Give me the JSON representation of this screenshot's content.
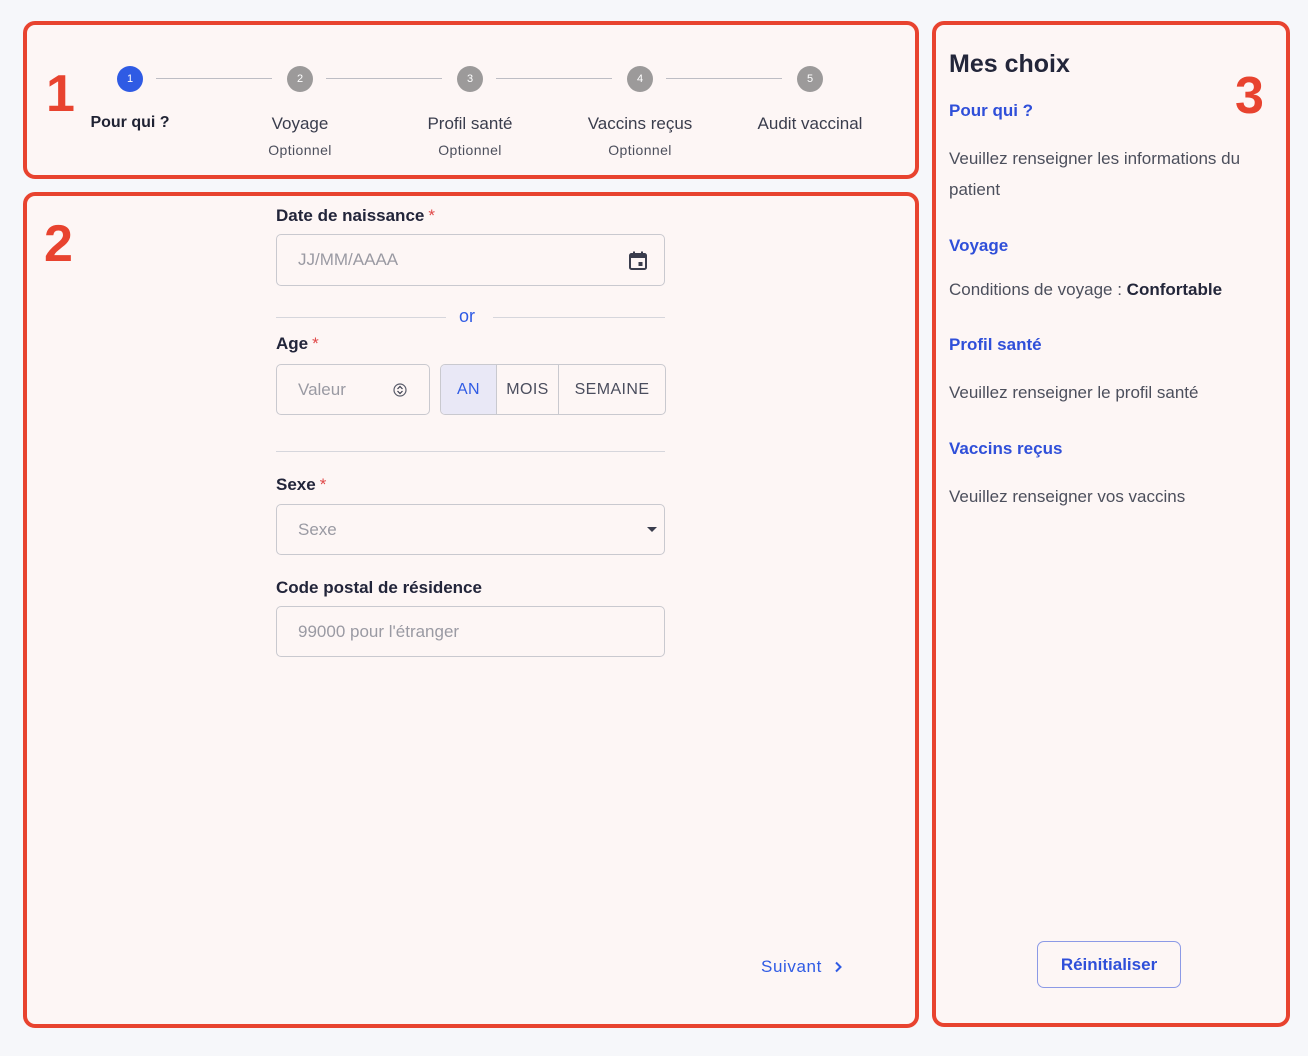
{
  "stepper": {
    "steps": [
      {
        "number": "1",
        "label": "Pour qui ?",
        "sub": ""
      },
      {
        "number": "2",
        "label": "Voyage",
        "sub": "Optionnel"
      },
      {
        "number": "3",
        "label": "Profil santé",
        "sub": "Optionnel"
      },
      {
        "number": "4",
        "label": "Vaccins reçus",
        "sub": "Optionnel"
      },
      {
        "number": "5",
        "label": "Audit vaccinal",
        "sub": ""
      }
    ],
    "active_step": 1
  },
  "form": {
    "birthdate": {
      "label": "Date de naissance",
      "required_mark": "*",
      "placeholder": "JJ/MM/AAAA"
    },
    "or_text": "or",
    "age": {
      "label": "Age",
      "required_mark": "*",
      "placeholder": "Valeur",
      "units": [
        "AN",
        "MOIS",
        "SEMAINE"
      ],
      "selected_unit": "AN"
    },
    "sex": {
      "label": "Sexe",
      "required_mark": "*",
      "placeholder": "Sexe"
    },
    "postal": {
      "label": "Code postal de résidence",
      "placeholder": "99000 pour l'étranger"
    },
    "next_label": "Suivant"
  },
  "sidebar": {
    "title": "Mes choix",
    "sections": [
      {
        "heading": "Pour qui ?",
        "text": "Veuillez renseigner les informations du patient"
      },
      {
        "heading": "Voyage",
        "text_prefix": "Conditions de voyage : ",
        "text_value": "Confortable"
      },
      {
        "heading": "Profil santé",
        "text": "Veuillez renseigner le profil santé"
      },
      {
        "heading": "Vaccins reçus",
        "text": "Veuillez renseigner vos vaccins"
      }
    ],
    "reset_label": "Réinitialiser"
  },
  "annotations": [
    "1",
    "2",
    "3"
  ],
  "colors": {
    "accent": "#2f5be4",
    "annotation": "#e8432f",
    "panel_bg": "#fdf6f5"
  }
}
